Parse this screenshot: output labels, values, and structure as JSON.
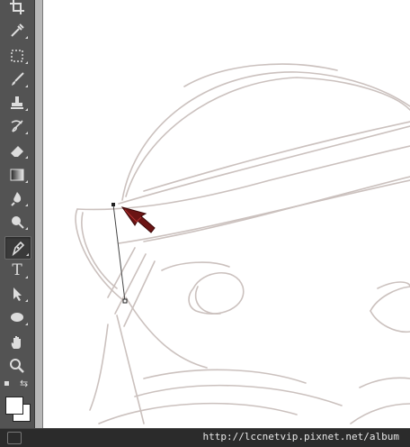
{
  "toolbar": {
    "tools": [
      {
        "name": "crop-tool",
        "icon": "crop-icon"
      },
      {
        "name": "eyedropper-tool",
        "icon": "eyedropper-icon"
      },
      {
        "name": "marquee-tool",
        "icon": "marquee-icon"
      },
      {
        "name": "brush-tool",
        "icon": "brush-icon"
      },
      {
        "name": "stamp-tool",
        "icon": "stamp-icon"
      },
      {
        "name": "history-brush-tool",
        "icon": "history-brush-icon"
      },
      {
        "name": "eraser-tool",
        "icon": "eraser-icon"
      },
      {
        "name": "gradient-tool",
        "icon": "gradient-icon"
      },
      {
        "name": "blur-tool",
        "icon": "blur-icon"
      },
      {
        "name": "dodge-tool",
        "icon": "dodge-icon"
      },
      {
        "name": "pen-tool",
        "icon": "pen-icon",
        "active": true
      },
      {
        "name": "type-tool",
        "icon": "type-icon",
        "glyph": "T"
      },
      {
        "name": "path-selection-tool",
        "icon": "arrow-icon"
      },
      {
        "name": "ellipse-tool",
        "icon": "ellipse-icon"
      },
      {
        "name": "hand-tool",
        "icon": "hand-icon"
      },
      {
        "name": "zoom-tool",
        "icon": "zoom-icon"
      }
    ],
    "foreground_color": "#ffffff",
    "background_color": "#ffffff"
  },
  "status": {
    "watermark": "http://lccnetvip.pixnet.net/album"
  },
  "colors": {
    "toolbar_bg": "#535353",
    "sketch_stroke": "#c9bfbc",
    "pointer_arrow": "#7a1111"
  }
}
